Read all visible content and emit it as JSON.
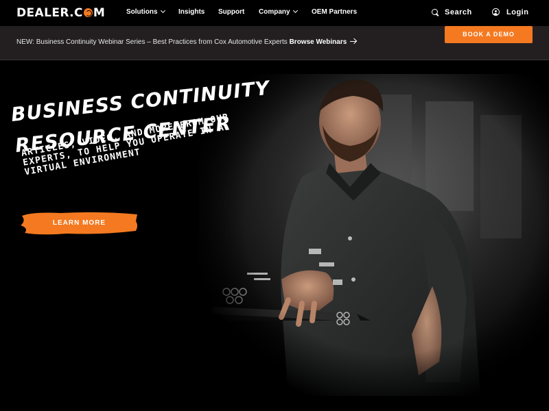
{
  "brand": {
    "name_left": "DEALER.C",
    "name_right": "M",
    "accent": "#f47920"
  },
  "nav": {
    "items": [
      {
        "label": "Solutions",
        "has_menu": true
      },
      {
        "label": "Insights",
        "has_menu": false
      },
      {
        "label": "Support",
        "has_menu": false
      },
      {
        "label": "Company",
        "has_menu": true
      },
      {
        "label": "OEM Partners",
        "has_menu": false
      }
    ],
    "search_label": "Search",
    "login_label": "Login"
  },
  "announcement": {
    "text": "NEW: Business Continuity Webinar Series – Best Practices from Cox Automotive Experts ",
    "link_label": "Browse Webinars",
    "cta_label": "BOOK A DEMO"
  },
  "hero": {
    "title_line1": "BUSINESS CONTINUITY",
    "title_line2": "RESOURCE CENTER",
    "subtitle": "ARTICLES, VIDEO, AND MORE FROM OUR\nEXPERTS, TO HELP YOU OPERATE IN A\nVIRTUAL ENVIRONMENT",
    "cta_label": "LEARN MORE"
  }
}
